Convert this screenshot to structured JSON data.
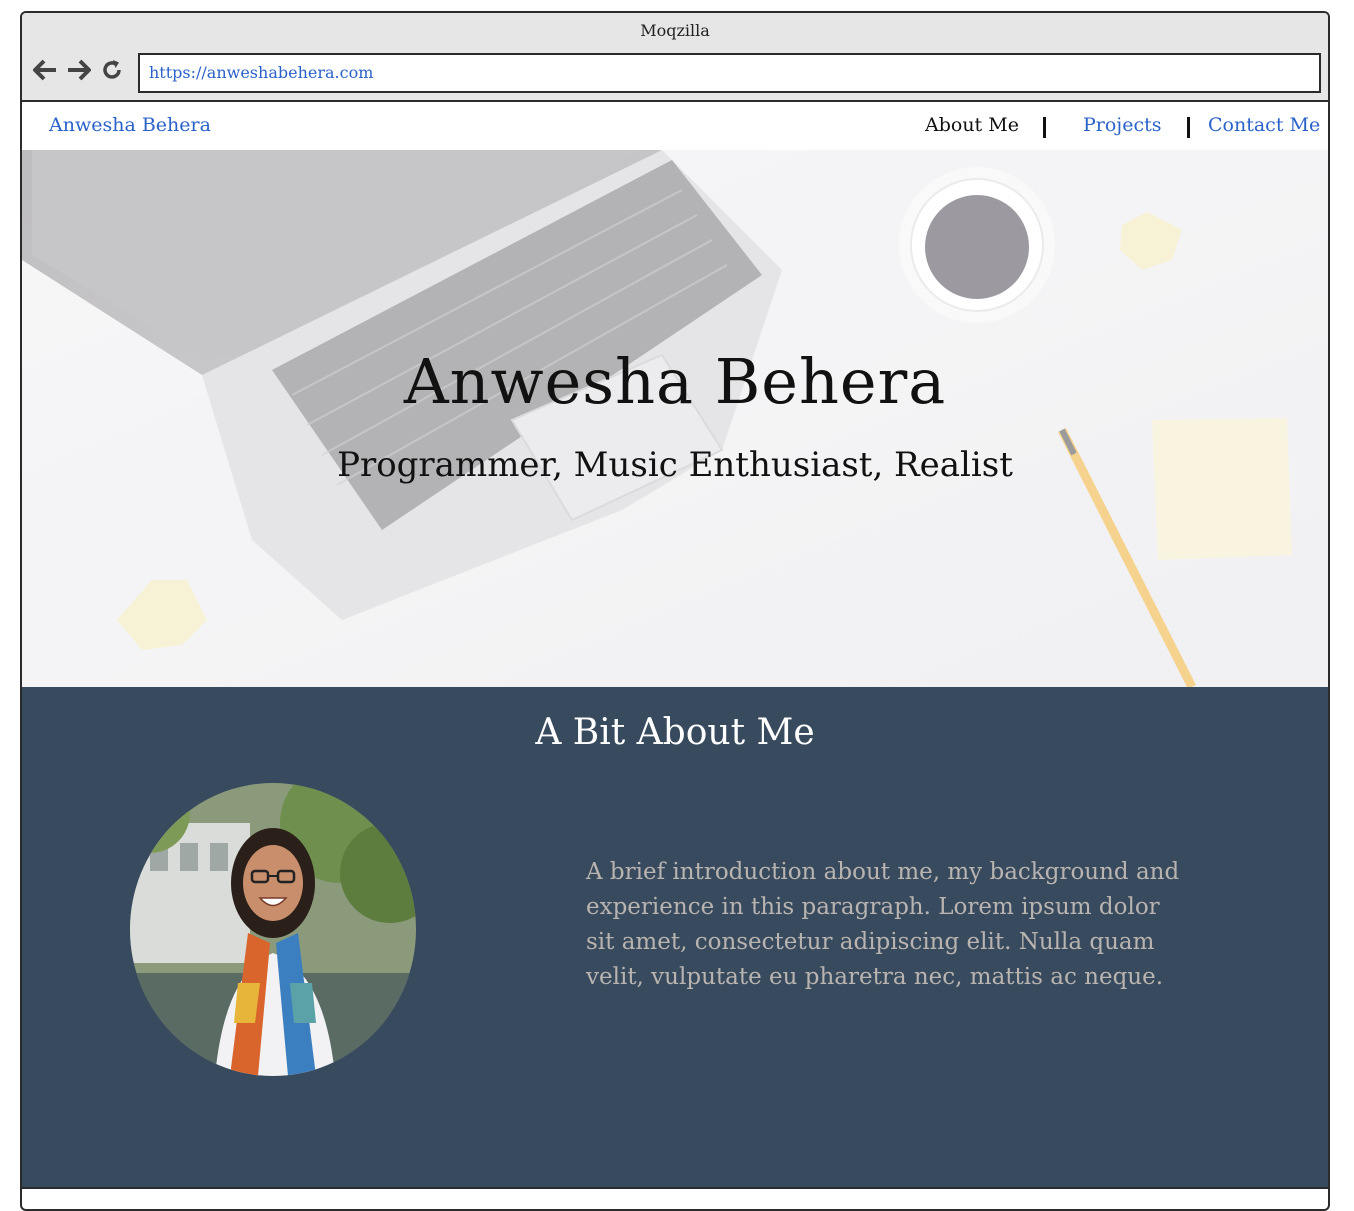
{
  "window": {
    "title": "Moqzilla",
    "url": "https://anweshabehera.com"
  },
  "toolbar": {
    "icons": [
      "back-arrow-icon",
      "forward-arrow-icon",
      "reload-icon"
    ]
  },
  "nav": {
    "brand": "Anwesha Behera",
    "links": [
      {
        "label": "About Me",
        "color": "#111111"
      },
      {
        "label": "Projects",
        "color": "#2a62c9"
      },
      {
        "label": "Contact Me",
        "color": "#2a62c9"
      }
    ]
  },
  "hero": {
    "title": "Anwesha Behera",
    "subtitle": "Programmer, Music Enthusiast, Realist"
  },
  "about": {
    "heading": "A Bit About Me",
    "paragraph": "A brief introduction about me, my background and experience in this paragraph. Lorem ipsum dolor sit amet, consectetur adipiscing elit. Nulla quam velit, vulputate eu pharetra nec, mattis ac neque.",
    "background_color": "#384a5e"
  },
  "colors": {
    "link": "#2a62c9",
    "chrome": "#e6e6e6"
  }
}
